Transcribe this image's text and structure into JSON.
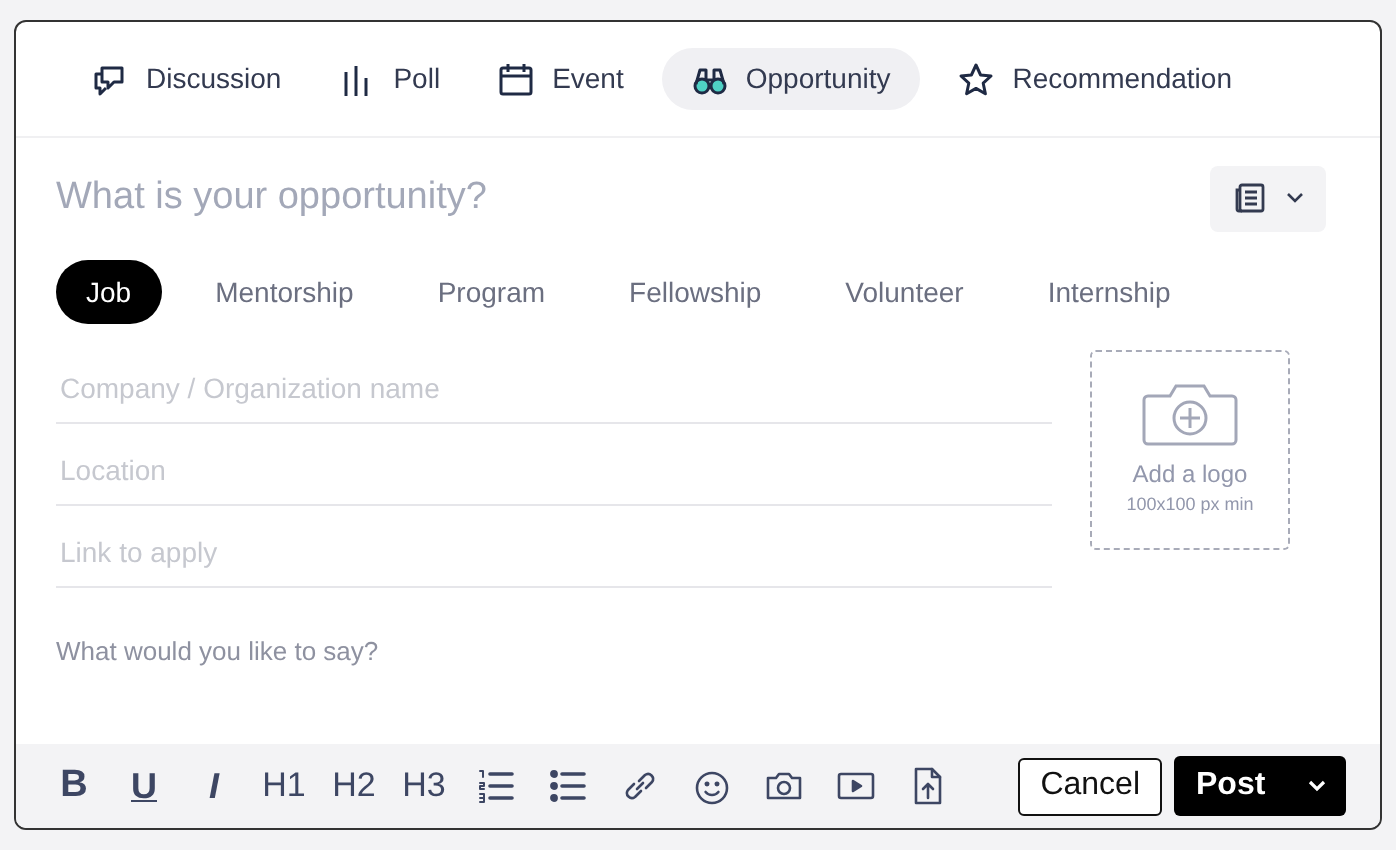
{
  "post_types": [
    {
      "label": "Discussion",
      "kind": "discussion",
      "selected": false
    },
    {
      "label": "Poll",
      "kind": "poll",
      "selected": false
    },
    {
      "label": "Event",
      "kind": "event",
      "selected": false
    },
    {
      "label": "Opportunity",
      "kind": "opportunity",
      "selected": true
    },
    {
      "label": "Recommendation",
      "kind": "recommendation",
      "selected": false
    }
  ],
  "title_field": {
    "placeholder": "What is your opportunity?"
  },
  "categories": [
    {
      "label": "Job",
      "selected": true
    },
    {
      "label": "Mentorship",
      "selected": false
    },
    {
      "label": "Program",
      "selected": false
    },
    {
      "label": "Fellowship",
      "selected": false
    },
    {
      "label": "Volunteer",
      "selected": false
    },
    {
      "label": "Internship",
      "selected": false
    }
  ],
  "fields": [
    {
      "placeholder": "Company / Organization name"
    },
    {
      "placeholder": "Location"
    },
    {
      "placeholder": "Link to apply"
    }
  ],
  "logo_upload": {
    "label": "Add a logo",
    "hint": "100x100 px min"
  },
  "body_field": {
    "placeholder": "What would you like to say?"
  },
  "toolbar": [
    {
      "kind": "bold",
      "text": "B"
    },
    {
      "kind": "underline",
      "text": "U"
    },
    {
      "kind": "italic",
      "text": "I"
    },
    {
      "kind": "heading",
      "text": "H1"
    },
    {
      "kind": "heading",
      "text": "H2"
    },
    {
      "kind": "heading",
      "text": "H3"
    },
    {
      "kind": "numbered"
    },
    {
      "kind": "bullets"
    },
    {
      "kind": "link"
    },
    {
      "kind": "emoji"
    },
    {
      "kind": "photo"
    },
    {
      "kind": "video"
    },
    {
      "kind": "upload"
    }
  ],
  "cancel_button": "Cancel",
  "post_button": "Post"
}
